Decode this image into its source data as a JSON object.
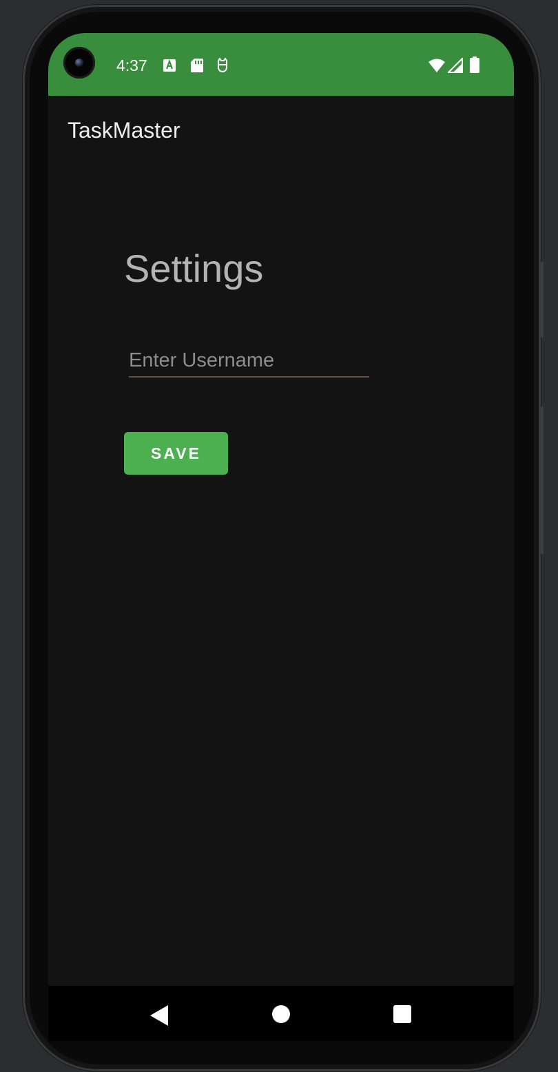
{
  "status_bar": {
    "time": "4:37",
    "background_color": "#388e3c",
    "notification_icons": [
      "text-a-icon",
      "sd-card-icon",
      "cat-icon"
    ],
    "system_icons": [
      "wifi-icon",
      "signal-icon",
      "battery-icon"
    ]
  },
  "app_bar": {
    "title": "TaskMaster"
  },
  "settings": {
    "heading": "Settings",
    "username_input": {
      "value": "",
      "placeholder": "Enter Username",
      "underline_color": "#6d4c41"
    },
    "save_button": {
      "label": "SAVE",
      "color": "#4caf50"
    }
  },
  "nav_bar": {
    "buttons": [
      "back-icon",
      "home-icon",
      "recents-icon"
    ]
  }
}
